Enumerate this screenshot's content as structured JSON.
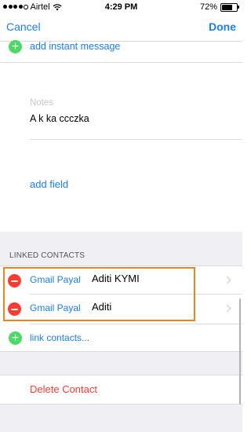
{
  "status_bar": {
    "carrier": "Airtel",
    "time": "4:29 PM",
    "battery_text": "72%",
    "battery_level": 0.72,
    "signal_bars_filled": 4,
    "signal_bars_total": 5,
    "wifi_icon": "wifi-icon"
  },
  "nav": {
    "cancel_label": "Cancel",
    "done_label": "Done"
  },
  "fields": {
    "add_instant_message": "add instant message",
    "notes_label": "Notes",
    "notes_value": "A k ka ccczka",
    "add_field": "add field"
  },
  "linked_contacts": {
    "header": "LINKED CONTACTS",
    "items": [
      {
        "source": "Gmail Payal",
        "name": "Aditi KYMI"
      },
      {
        "source": "Gmail Payal",
        "name": "Aditi"
      }
    ],
    "link_contacts_label": "link contacts..."
  },
  "actions": {
    "delete_contact": "Delete Contact"
  },
  "colors": {
    "accent": "#1a7ef5",
    "add_green": "#4cd964",
    "delete_red": "#ff3b30",
    "highlight_orange": "#e8851c",
    "group_background": "#efeff4"
  }
}
